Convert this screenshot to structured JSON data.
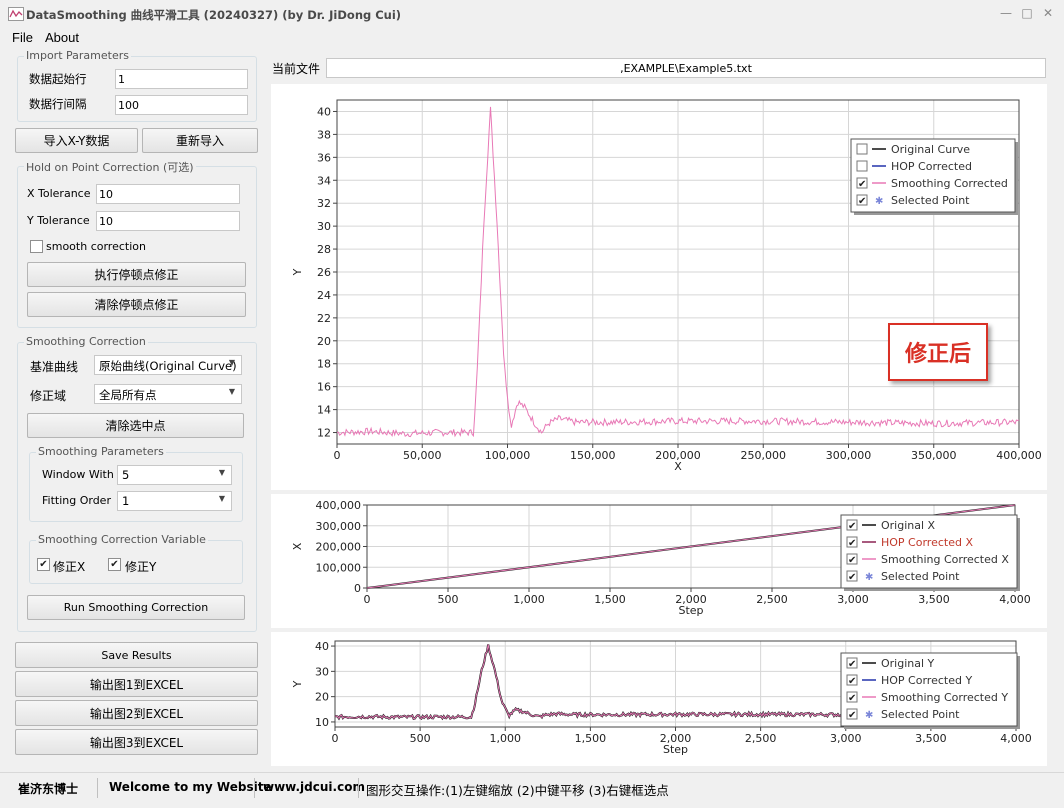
{
  "window": {
    "title": "DataSmoothing 曲线平滑工具 (20240327) (by Dr. JiDong Cui)",
    "minimize": "—",
    "maximize": "□",
    "close": "✕"
  },
  "menu": [
    "File",
    "About"
  ],
  "import": {
    "title": "Import Parameters",
    "start_row_label": "数据起始行",
    "start_row_value": "1",
    "row_interval_label": "数据行间隔",
    "row_interval_value": "100",
    "import_button": "导入X-Y数据",
    "reimport_button": "重新导入"
  },
  "hop": {
    "title": "Hold on Point Correction (可选)",
    "x_tol_label": "X Tolerance",
    "x_tol_value": "10",
    "y_tol_label": "Y Tolerance",
    "y_tol_value": "10",
    "smooth_label": "smooth correction",
    "run_button": "执行停顿点修正",
    "clear_button": "清除停顿点修正"
  },
  "smoothing": {
    "title": "Smoothing Correction",
    "base_label": "基准曲线",
    "base_value": "原始曲线(Original Curve)",
    "domain_label": "修正域",
    "domain_value": "全局所有点",
    "clear_button": "清除选中点",
    "params_title": "Smoothing Parameters",
    "window_label": "Window With",
    "window_value": "5",
    "order_label": "Fitting Order",
    "order_value": "1",
    "var_title": "Smoothing Correction Variable",
    "fix_x": "修正X",
    "fix_y": "修正Y",
    "run_button": "Run Smoothing Correction"
  },
  "actions": {
    "save": "Save Results",
    "export1": "输出图1到EXCEL",
    "export2": "输出图2到EXCEL",
    "export3": "输出图3到EXCEL"
  },
  "file": {
    "label": "当前文件",
    "path": ",EXAMPLE\\Example5.txt"
  },
  "annotation": "修正后",
  "colors": {
    "pink": "#e879b6",
    "dark": "#1a1a1a",
    "maroon": "#8b2252",
    "blue": "#2233aa",
    "annotation_red": "#d93025"
  },
  "chart_data": [
    {
      "type": "line",
      "xlabel": "X",
      "ylabel": "Y",
      "xlim": [
        0,
        400000
      ],
      "ylim": [
        11,
        41
      ],
      "x_ticks": [
        "0",
        "50,000",
        "100,000",
        "150,000",
        "200,000",
        "250,000",
        "300,000",
        "350,000",
        "400,000"
      ],
      "y_ticks": [
        "12",
        "14",
        "16",
        "18",
        "20",
        "22",
        "24",
        "26",
        "28",
        "30",
        "32",
        "34",
        "36",
        "38",
        "40"
      ],
      "legend": [
        {
          "name": "Original Curve",
          "checked": false
        },
        {
          "name": "HOP Corrected",
          "checked": false
        },
        {
          "name": "Smoothing Corrected",
          "checked": true
        },
        {
          "name": "Selected Point",
          "checked": true
        }
      ],
      "series": [
        {
          "name": "Smoothing Corrected",
          "x": [
            0,
            20000,
            40000,
            60000,
            80000,
            82000,
            86000,
            90000,
            94000,
            98000,
            102000,
            106000,
            110000,
            116000,
            120000,
            124000,
            130000,
            140000,
            160000,
            200000,
            250000,
            300000,
            350000,
            400000
          ],
          "values": [
            12.0,
            12.1,
            11.9,
            12.0,
            12.0,
            16.5,
            30.0,
            40.2,
            30.0,
            18.0,
            12.5,
            14.7,
            14.2,
            12.8,
            12.0,
            12.8,
            13.2,
            12.9,
            12.9,
            13.0,
            13.0,
            12.9,
            12.8,
            12.9
          ]
        }
      ]
    },
    {
      "type": "line",
      "xlabel": "Step",
      "ylabel": "X",
      "xlim": [
        0,
        4000
      ],
      "ylim": [
        0,
        400000
      ],
      "x_ticks": [
        "0",
        "500",
        "1,000",
        "1,500",
        "2,000",
        "2,500",
        "3,000",
        "3,500",
        "4,000"
      ],
      "y_ticks": [
        "0",
        "100,000",
        "200,000",
        "300,000",
        "400,000"
      ],
      "legend": [
        {
          "name": "Original X",
          "checked": true
        },
        {
          "name": "HOP Corrected X",
          "checked": true
        },
        {
          "name": "Smoothing Corrected X",
          "checked": true
        },
        {
          "name": "Selected Point",
          "checked": true
        }
      ],
      "series": [
        {
          "name": "Original X",
          "x": [
            0,
            4000
          ],
          "values": [
            0,
            400000
          ]
        }
      ]
    },
    {
      "type": "line",
      "xlabel": "Step",
      "ylabel": "Y",
      "xlim": [
        0,
        4000
      ],
      "ylim": [
        8,
        42
      ],
      "x_ticks": [
        "0",
        "500",
        "1,000",
        "1,500",
        "2,000",
        "2,500",
        "3,000",
        "3,500",
        "4,000"
      ],
      "y_ticks": [
        "10",
        "20",
        "30",
        "40"
      ],
      "legend": [
        {
          "name": "Original Y",
          "checked": true
        },
        {
          "name": "HOP Corrected Y",
          "checked": true
        },
        {
          "name": "Smoothing Corrected Y",
          "checked": true
        },
        {
          "name": "Selected Point",
          "checked": true
        }
      ],
      "series": [
        {
          "name": "Original Y",
          "x": [
            0,
            200,
            400,
            600,
            800,
            820,
            860,
            900,
            940,
            980,
            1020,
            1060,
            1100,
            1160,
            1200,
            1240,
            1300,
            1400,
            1600,
            2000,
            2500,
            3000,
            3500,
            4000
          ],
          "values": [
            12.0,
            12.1,
            11.9,
            12.0,
            12.0,
            16.5,
            30.0,
            40.2,
            30.0,
            18.0,
            12.5,
            14.7,
            14.2,
            12.8,
            12.0,
            12.8,
            13.2,
            12.9,
            12.9,
            13.0,
            13.0,
            12.9,
            12.8,
            12.9
          ]
        }
      ]
    }
  ],
  "status": {
    "author": "崔济东博士",
    "welcome": "Welcome to my Website",
    "site": "www.jdcui.com",
    "hint": "图形交互操作:(1)左键缩放 (2)中键平移 (3)右键框选点"
  }
}
